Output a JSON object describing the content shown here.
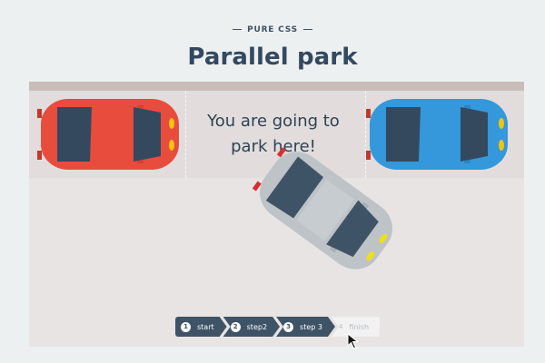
{
  "header": {
    "eyebrow": "PURE CSS",
    "title": "Parallel park"
  },
  "scene": {
    "message": "You are going to park here!"
  },
  "steps": [
    {
      "number": "1",
      "label": "start"
    },
    {
      "number": "2",
      "label": "step2"
    },
    {
      "number": "3",
      "label": "step 3"
    },
    {
      "number": "4",
      "label": "finish"
    }
  ],
  "colors": {
    "background": "#edf0f1",
    "road": "#e8e4e3",
    "parking_lane": "#e2dddc",
    "top_band": "#c9bdb9",
    "red_car": "#e84c3d",
    "blue_car": "#3498db",
    "gray_car": "#bdc3c7",
    "windows": "#34495e",
    "step_active": "#3e5366",
    "step_disabled": "#f2f2f2"
  }
}
